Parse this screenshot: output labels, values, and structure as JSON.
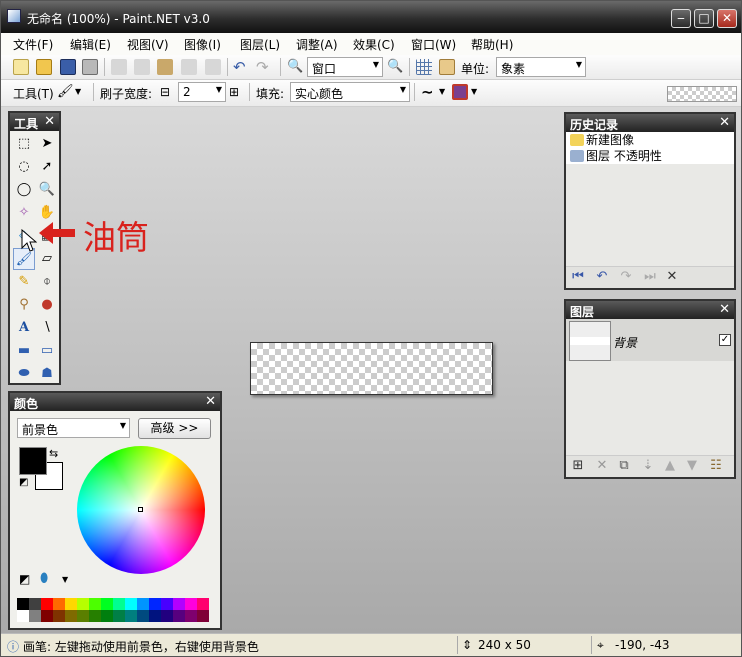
{
  "window": {
    "title": "无命名 (100%) - Paint.NET v3.0",
    "min": "‒",
    "max": "□",
    "close": "✕"
  },
  "menu": [
    "文件(F)",
    "编辑(E)",
    "视图(V)",
    "图像(I)",
    "图层(L)",
    "调整(A)",
    "效果(C)",
    "窗口(W)",
    "帮助(H)"
  ],
  "toolbar1": {
    "zoom_value": "窗口",
    "unit_label": "单位:",
    "unit_value": "象素"
  },
  "toolbar2": {
    "tool_label": "工具(T)",
    "brush_label": "刷子宽度:",
    "brush_minus": "⊟",
    "brush_value": "2",
    "brush_plus": "⊞",
    "fill_label": "填充:",
    "fill_value": "实心颜色"
  },
  "tools_panel": {
    "title": "工具",
    "close": "✕"
  },
  "annotation": "油筒",
  "history_panel": {
    "title": "历史记录",
    "close": "✕",
    "items": [
      "新建图像",
      "图层 不透明性"
    ]
  },
  "layers_panel": {
    "title": "图层",
    "close": "✕",
    "layer_name": "背景",
    "check": "✓"
  },
  "colors_panel": {
    "title": "颜色",
    "close": "✕",
    "mode": "前景色",
    "advanced": "高级 >>"
  },
  "status": {
    "hint": "画笔: 左键拖动使用前景色，右键使用背景色",
    "size": "240 x 50",
    "coords": "-190, -43"
  },
  "colors": {
    "palette_top": [
      "#000000",
      "#404040",
      "#ff0000",
      "#ff6a00",
      "#ffd800",
      "#b6ff00",
      "#4cff00",
      "#00ff21",
      "#00ff90",
      "#00ffff",
      "#0094ff",
      "#0026ff",
      "#4800ff",
      "#b200ff",
      "#ff00dc",
      "#ff006e"
    ],
    "palette_bottom": [
      "#ffffff",
      "#808080",
      "#7f0000",
      "#7f3300",
      "#7f6a00",
      "#5b7f00",
      "#267f00",
      "#007f0e",
      "#007f46",
      "#007f7f",
      "#004a7f",
      "#00137f",
      "#21007f",
      "#57007f",
      "#7f006e",
      "#7f0037"
    ]
  }
}
